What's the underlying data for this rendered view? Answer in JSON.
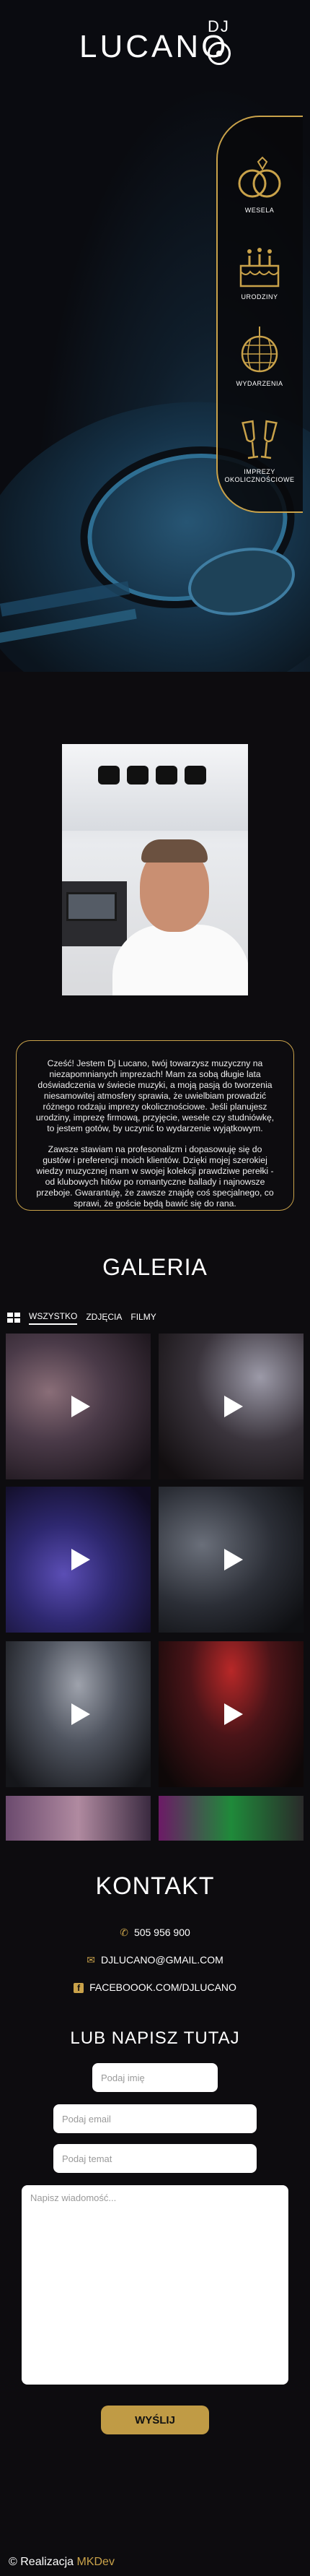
{
  "logo": {
    "dj": "DJ",
    "word": "LUCANO"
  },
  "services": [
    {
      "label": "WESELA",
      "icon": "wedding-rings-icon"
    },
    {
      "label": "URODZINY",
      "icon": "birthday-cake-icon"
    },
    {
      "label": "WYDARZENIA",
      "icon": "disco-ball-icon"
    },
    {
      "label": "IMPREZY OKOLICZNOŚCIOWE",
      "icon": "champagne-glasses-icon"
    }
  ],
  "about": {
    "p1": "Cześć! Jestem Dj Lucano, twój towarzysz muzyczny na niezapomnianych imprezach! Mam za sobą długie lata doświadczenia w świecie muzyki, a moją pasją do tworzenia niesamowitej atmosfery sprawia, że uwielbiam prowadzić różnego rodzaju imprezy okolicznościowe. Jeśli planujesz urodziny, imprezę firmową, przyjęcie, wesele czy studniówkę, to jestem gotów, by uczynić to wydarzenie wyjątkowym.",
    "p2": "Zawsze stawiam na profesonalizm i dopasowuję się do gustów i preferencji moich klientów. Dzięki mojej szerokiej wiedzy muzycznej mam w swojej kolekcji prawdziwe perełki - od klubowych hitów po romantyczne ballady i najnowsze przeboje. Gwarantuję, że zawsze znajdę coś specjalnego, co sprawi, że goście będą bawić się do rana."
  },
  "gallery": {
    "title": "GALERIA",
    "filters": [
      "WSZYSTKO",
      "ZDJĘCIA",
      "FILMY"
    ],
    "active_filter": "WSZYSTKO"
  },
  "contact": {
    "title": "KONTAKT",
    "phone": "505 956 900",
    "email": "DJLUCANO@GMAIL.COM",
    "facebook": "FACEBOOOK.COM/DJLUCANO",
    "form_title": "LUB NAPISZ TUTAJ",
    "name_placeholder": "Podaj imię",
    "email_placeholder": "Podaj email",
    "subject_placeholder": "Podaj temat",
    "message_placeholder": "Napisz wiadomość...",
    "send_label": "WYŚLIJ"
  },
  "footer": {
    "prefix": "© Realizacja",
    "brand": "MKDev"
  },
  "colors": {
    "accent": "#c9a24a",
    "background": "#0d0c0f"
  }
}
